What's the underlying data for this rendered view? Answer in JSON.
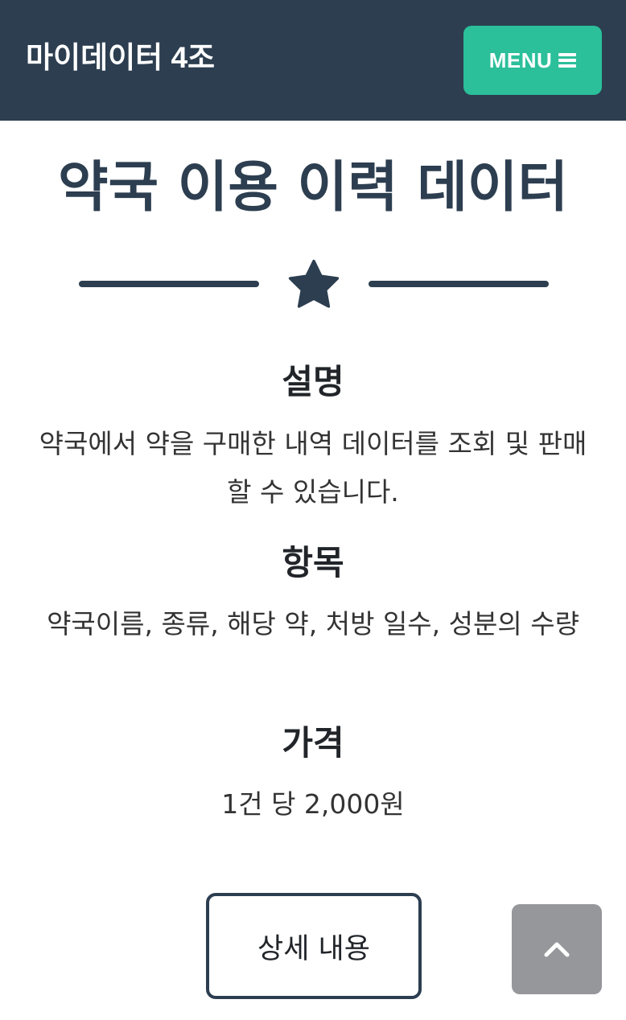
{
  "navbar": {
    "brand": "마이데이터 4조",
    "menu_label": "MENU",
    "menu_icon": "bars-icon",
    "background_color": "#2c3e50",
    "menu_color": "#2bbf9a"
  },
  "page": {
    "title": "약국 이용 이력 데이터",
    "divider_icon": "star-icon"
  },
  "sections": {
    "description": {
      "heading": "설명",
      "text": "약국에서 약을 구매한 내역 데이터를 조회 및 판매할 수 있습니다."
    },
    "fields": {
      "heading": "항목",
      "text": "약국이름, 종류, 해당 약, 처방 일수, 성분의 수량"
    },
    "price": {
      "heading": "가격",
      "text": "1건 당 2,000원"
    }
  },
  "actions": {
    "detail_label": "상세 내용",
    "scroll_top_icon": "chevron-up-icon"
  }
}
